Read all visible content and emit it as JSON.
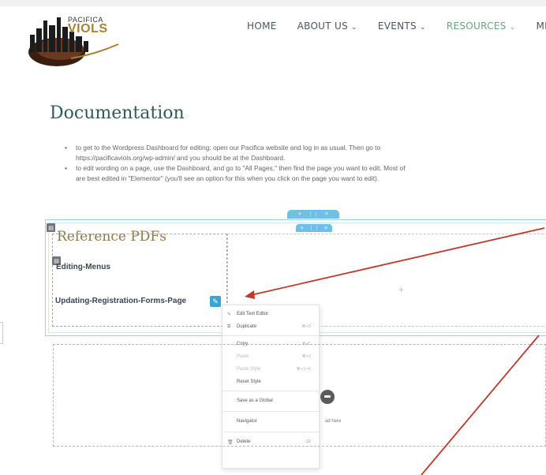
{
  "header": {
    "logo_line1": "PACIFICA",
    "logo_line2": "VIOLS",
    "nav": [
      {
        "label": "HOME",
        "dropdown": false,
        "active": false
      },
      {
        "label": "ABOUT US",
        "dropdown": true,
        "active": false
      },
      {
        "label": "EVENTS",
        "dropdown": true,
        "active": false
      },
      {
        "label": "RESOURCES",
        "dropdown": true,
        "active": true
      },
      {
        "label": "MEMB",
        "dropdown": false,
        "active": false
      }
    ],
    "chevron": "⌄"
  },
  "main": {
    "title": "Documentation",
    "bullets": [
      "to get to the Wordpress Dashboard for editing: open our Pacifica website and log in as usual. Then go to",
      "https://pacificaviols.org/wp-admin/ and you should be at the Dashboard.",
      "to edit wording on a page, use the Dashboard, and go to \"All Pages,\" then find the page you want to edit. Most of",
      "are best edited in \"Elementor\" (you'll see an option for this when you click on the page you want to edit)."
    ],
    "section_title": "Reference PDFs",
    "links": [
      "Editing-Menus",
      "Updating-Registration-Forms-Page"
    ],
    "drag_text": "ad here"
  },
  "context_menu": {
    "items": [
      {
        "label": "Edit Text Editor",
        "icon": "pencil-icon",
        "shortcut": "",
        "dim": false
      },
      {
        "label": "Duplicate",
        "icon": "duplicate-icon",
        "shortcut": "⌘+D",
        "dim": false
      },
      {
        "label": "Copy",
        "icon": "",
        "shortcut": "⌘+C",
        "dim": false
      },
      {
        "label": "Paste",
        "icon": "",
        "shortcut": "⌘+V",
        "dim": true
      },
      {
        "label": "Paste Style",
        "icon": "",
        "shortcut": "⌘+⇧+V",
        "dim": true
      },
      {
        "label": "Reset Style",
        "icon": "",
        "shortcut": "",
        "dim": false
      },
      {
        "label": "Save as a Global",
        "icon": "",
        "shortcut": "",
        "dim": false
      },
      {
        "label": "Navigator",
        "icon": "",
        "shortcut": "",
        "dim": false
      },
      {
        "label": "Delete",
        "icon": "trash-icon",
        "shortcut": "⌫",
        "dim": false
      }
    ]
  },
  "colors": {
    "accent_blue": "#6ec1e4",
    "arrow_red": "#c0392b",
    "nav_active": "#6aa67c",
    "title_teal": "#305a5a"
  }
}
